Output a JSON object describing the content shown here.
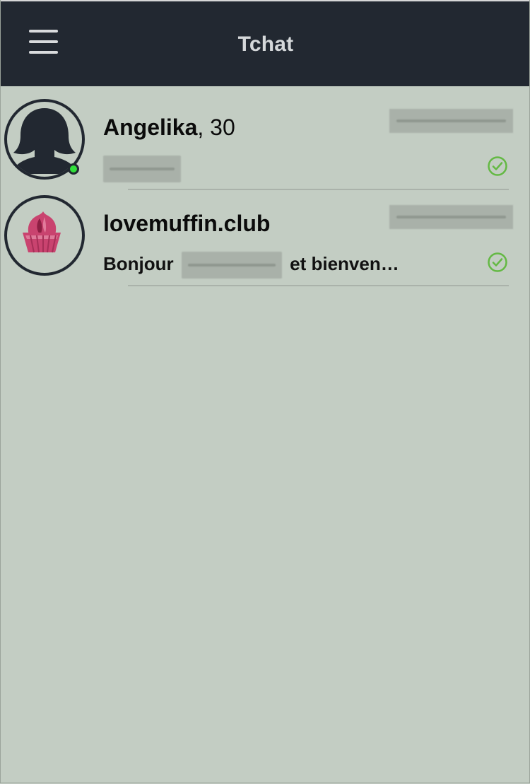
{
  "header": {
    "title": "Tchat",
    "menu_icon": "hamburger-menu-icon",
    "background": "#222831",
    "title_color": "#d5d8da"
  },
  "conversations": [
    {
      "name": "Angelika",
      "age_suffix": ", 30",
      "preview": "",
      "preview_redacted": true,
      "date_redacted": true,
      "online": true,
      "avatar_icon": "female-silhouette-icon",
      "status_icon": "check-circle-icon"
    },
    {
      "name": "lovemuffin.club",
      "preview_start": "Bonjour",
      "preview_end": "et bienven…",
      "preview_redacted": true,
      "date_redacted": true,
      "online": false,
      "avatar_icon": "lovemuffin-logo-icon",
      "status_icon": "check-circle-icon"
    }
  ],
  "colors": {
    "background": "#c3cdc3",
    "online_green": "#31e03b",
    "check_green": "#64b944",
    "logo_pink": "#c9436f"
  }
}
